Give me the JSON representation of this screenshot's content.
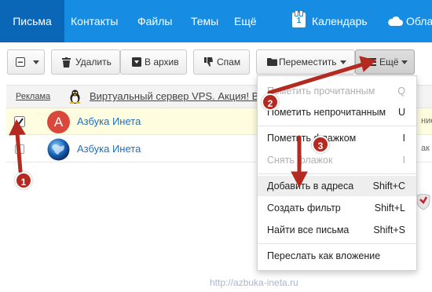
{
  "nav": {
    "items": [
      {
        "label": "Письма"
      },
      {
        "label": "Контакты"
      },
      {
        "label": "Файлы"
      },
      {
        "label": "Темы"
      },
      {
        "label": "Ещё"
      }
    ],
    "calendar_label": "Календарь",
    "calendar_day": "1",
    "cloud_label": "Обла"
  },
  "toolbar": {
    "delete_label": "Удалить",
    "archive_label": "В архив",
    "spam_label": "Спам",
    "move_label": "Переместить",
    "more_label": "Ещё"
  },
  "ad": {
    "label": "Реклама",
    "text": "Виртуальный сервер VPS. Акция! Ві"
  },
  "messages": [
    {
      "sender": "Азбука Инета",
      "avatar_letter": "А",
      "checked": true,
      "tail": "ние"
    },
    {
      "sender": "Азбука Инета",
      "checked": false,
      "tail": "ак"
    }
  ],
  "menu": {
    "items": [
      {
        "label": "Пометить прочитанным",
        "shortcut": "Q",
        "disabled": true
      },
      {
        "label": "Пометить непрочитанным",
        "shortcut": "U",
        "disabled": false
      },
      {
        "label": "Пометить флажком",
        "shortcut": "I",
        "disabled": false
      },
      {
        "label": "Снять флажок",
        "shortcut": "I",
        "disabled": true
      },
      {
        "label": "Добавить в адреса",
        "shortcut": "Shift+C",
        "disabled": false
      },
      {
        "label": "Создать фильтр",
        "shortcut": "Shift+L",
        "disabled": false
      },
      {
        "label": "Найти все письма",
        "shortcut": "Shift+S",
        "disabled": false
      },
      {
        "label": "Переслать как вложение",
        "shortcut": "",
        "disabled": false
      }
    ]
  },
  "annotations": {
    "step1": "1",
    "step2": "2",
    "step3": "3"
  },
  "footer": {
    "url": "http://azbuka-ineta.ru"
  },
  "colors": {
    "nav_bg": "#168de2",
    "nav_active": "#0a66b7",
    "link": "#1e70bf",
    "marker": "#b52a20",
    "selected_row": "#fffde0"
  }
}
